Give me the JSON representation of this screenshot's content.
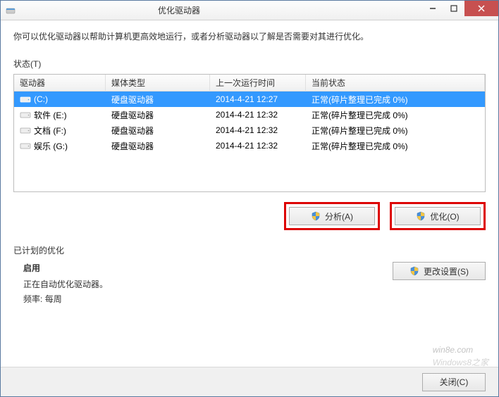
{
  "window": {
    "title": "优化驱动器"
  },
  "description": "你可以优化驱动器以帮助计算机更高效地运行，或者分析驱动器以了解是否需要对其进行优化。",
  "status_section_label": "状态(T)",
  "columns": {
    "drive": "驱动器",
    "media": "媒体类型",
    "last_run": "上一次运行时间",
    "status": "当前状态"
  },
  "drives": [
    {
      "name": "(C:)",
      "media": "硬盘驱动器",
      "last_run": "2014-4-21 12:27",
      "status": "正常(碎片整理已完成 0%)",
      "selected": true,
      "icon_tint": "#4aa3df"
    },
    {
      "name": "软件 (E:)",
      "media": "硬盘驱动器",
      "last_run": "2014-4-21 12:32",
      "status": "正常(碎片整理已完成 0%)",
      "selected": false,
      "icon_tint": "#999"
    },
    {
      "name": "文档 (F:)",
      "media": "硬盘驱动器",
      "last_run": "2014-4-21 12:32",
      "status": "正常(碎片整理已完成 0%)",
      "selected": false,
      "icon_tint": "#999"
    },
    {
      "name": "娱乐 (G:)",
      "media": "硬盘驱动器",
      "last_run": "2014-4-21 12:32",
      "status": "正常(碎片整理已完成 0%)",
      "selected": false,
      "icon_tint": "#999"
    }
  ],
  "buttons": {
    "analyze": "分析(A)",
    "optimize": "优化(O)",
    "change_settings": "更改设置(S)",
    "close": "关闭(C)"
  },
  "schedule": {
    "section_label": "已计划的优化",
    "enabled_label": "启用",
    "status_line": "正在自动优化驱动器。",
    "frequency_label": "频率:",
    "frequency_value": "每周"
  },
  "watermark": {
    "main": "win8e",
    "suffix": ".com",
    "sub": "Windows8之家"
  }
}
